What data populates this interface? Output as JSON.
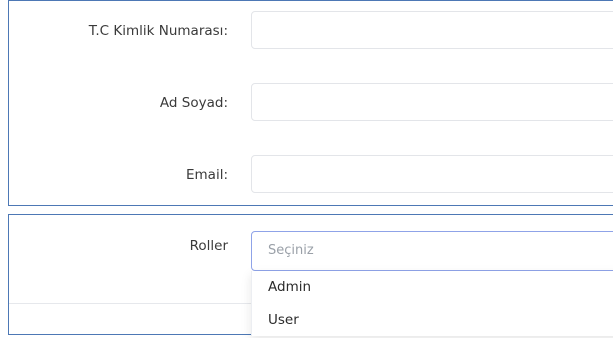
{
  "form": {
    "tc_label": "T.C Kimlik Numarası:",
    "tc_value": "",
    "name_label": "Ad Soyad:",
    "name_value": "",
    "email_label": "Email:",
    "email_value": ""
  },
  "roles": {
    "label": "Roller",
    "placeholder": "Seçiniz",
    "options": [
      "Admin",
      "User"
    ]
  },
  "colors": {
    "panel_border": "#4d78b5",
    "select_border": "#8fa3e8",
    "input_border": "#e3e5e9",
    "placeholder": "#9aa0a8"
  }
}
